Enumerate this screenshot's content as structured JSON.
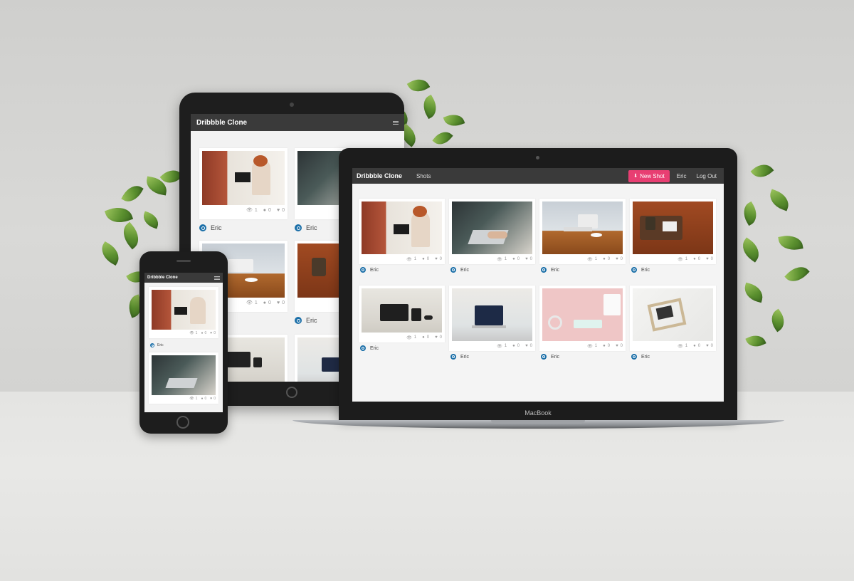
{
  "app": {
    "brand": "Dribbble Clone",
    "nav_shots": "Shots",
    "new_shot_label": "New Shot",
    "user_name": "Eric",
    "logout_label": "Log Out"
  },
  "device": {
    "laptop_label": "MacBook"
  },
  "shots": [
    {
      "author": "Eric",
      "views": "1",
      "comments": "0",
      "likes": "0",
      "scene": "brick"
    },
    {
      "author": "Eric",
      "views": "1",
      "comments": "0",
      "likes": "0",
      "scene": "dark"
    },
    {
      "author": "Eric",
      "views": "1",
      "comments": "0",
      "likes": "0",
      "scene": "desk"
    },
    {
      "author": "Eric",
      "views": "1",
      "comments": "0",
      "likes": "0",
      "scene": "floor"
    },
    {
      "author": "Eric",
      "views": "1",
      "comments": "0",
      "likes": "0",
      "scene": "shelf"
    },
    {
      "author": "Eric",
      "views": "1",
      "comments": "0",
      "likes": "0",
      "scene": "office"
    },
    {
      "author": "Eric",
      "views": "1",
      "comments": "0",
      "likes": "0",
      "scene": "pink"
    },
    {
      "author": "Eric",
      "views": "1",
      "comments": "0",
      "likes": "0",
      "scene": "white"
    }
  ],
  "icons": {
    "views": "eye-icon",
    "comments": "comment-icon",
    "likes": "heart-icon",
    "upload": "upload-icon",
    "menu": "hamburger-menu-icon"
  },
  "colors": {
    "accent": "#e83e72",
    "navbar": "#3a3a3a",
    "avatar": "#1b6fa8"
  }
}
